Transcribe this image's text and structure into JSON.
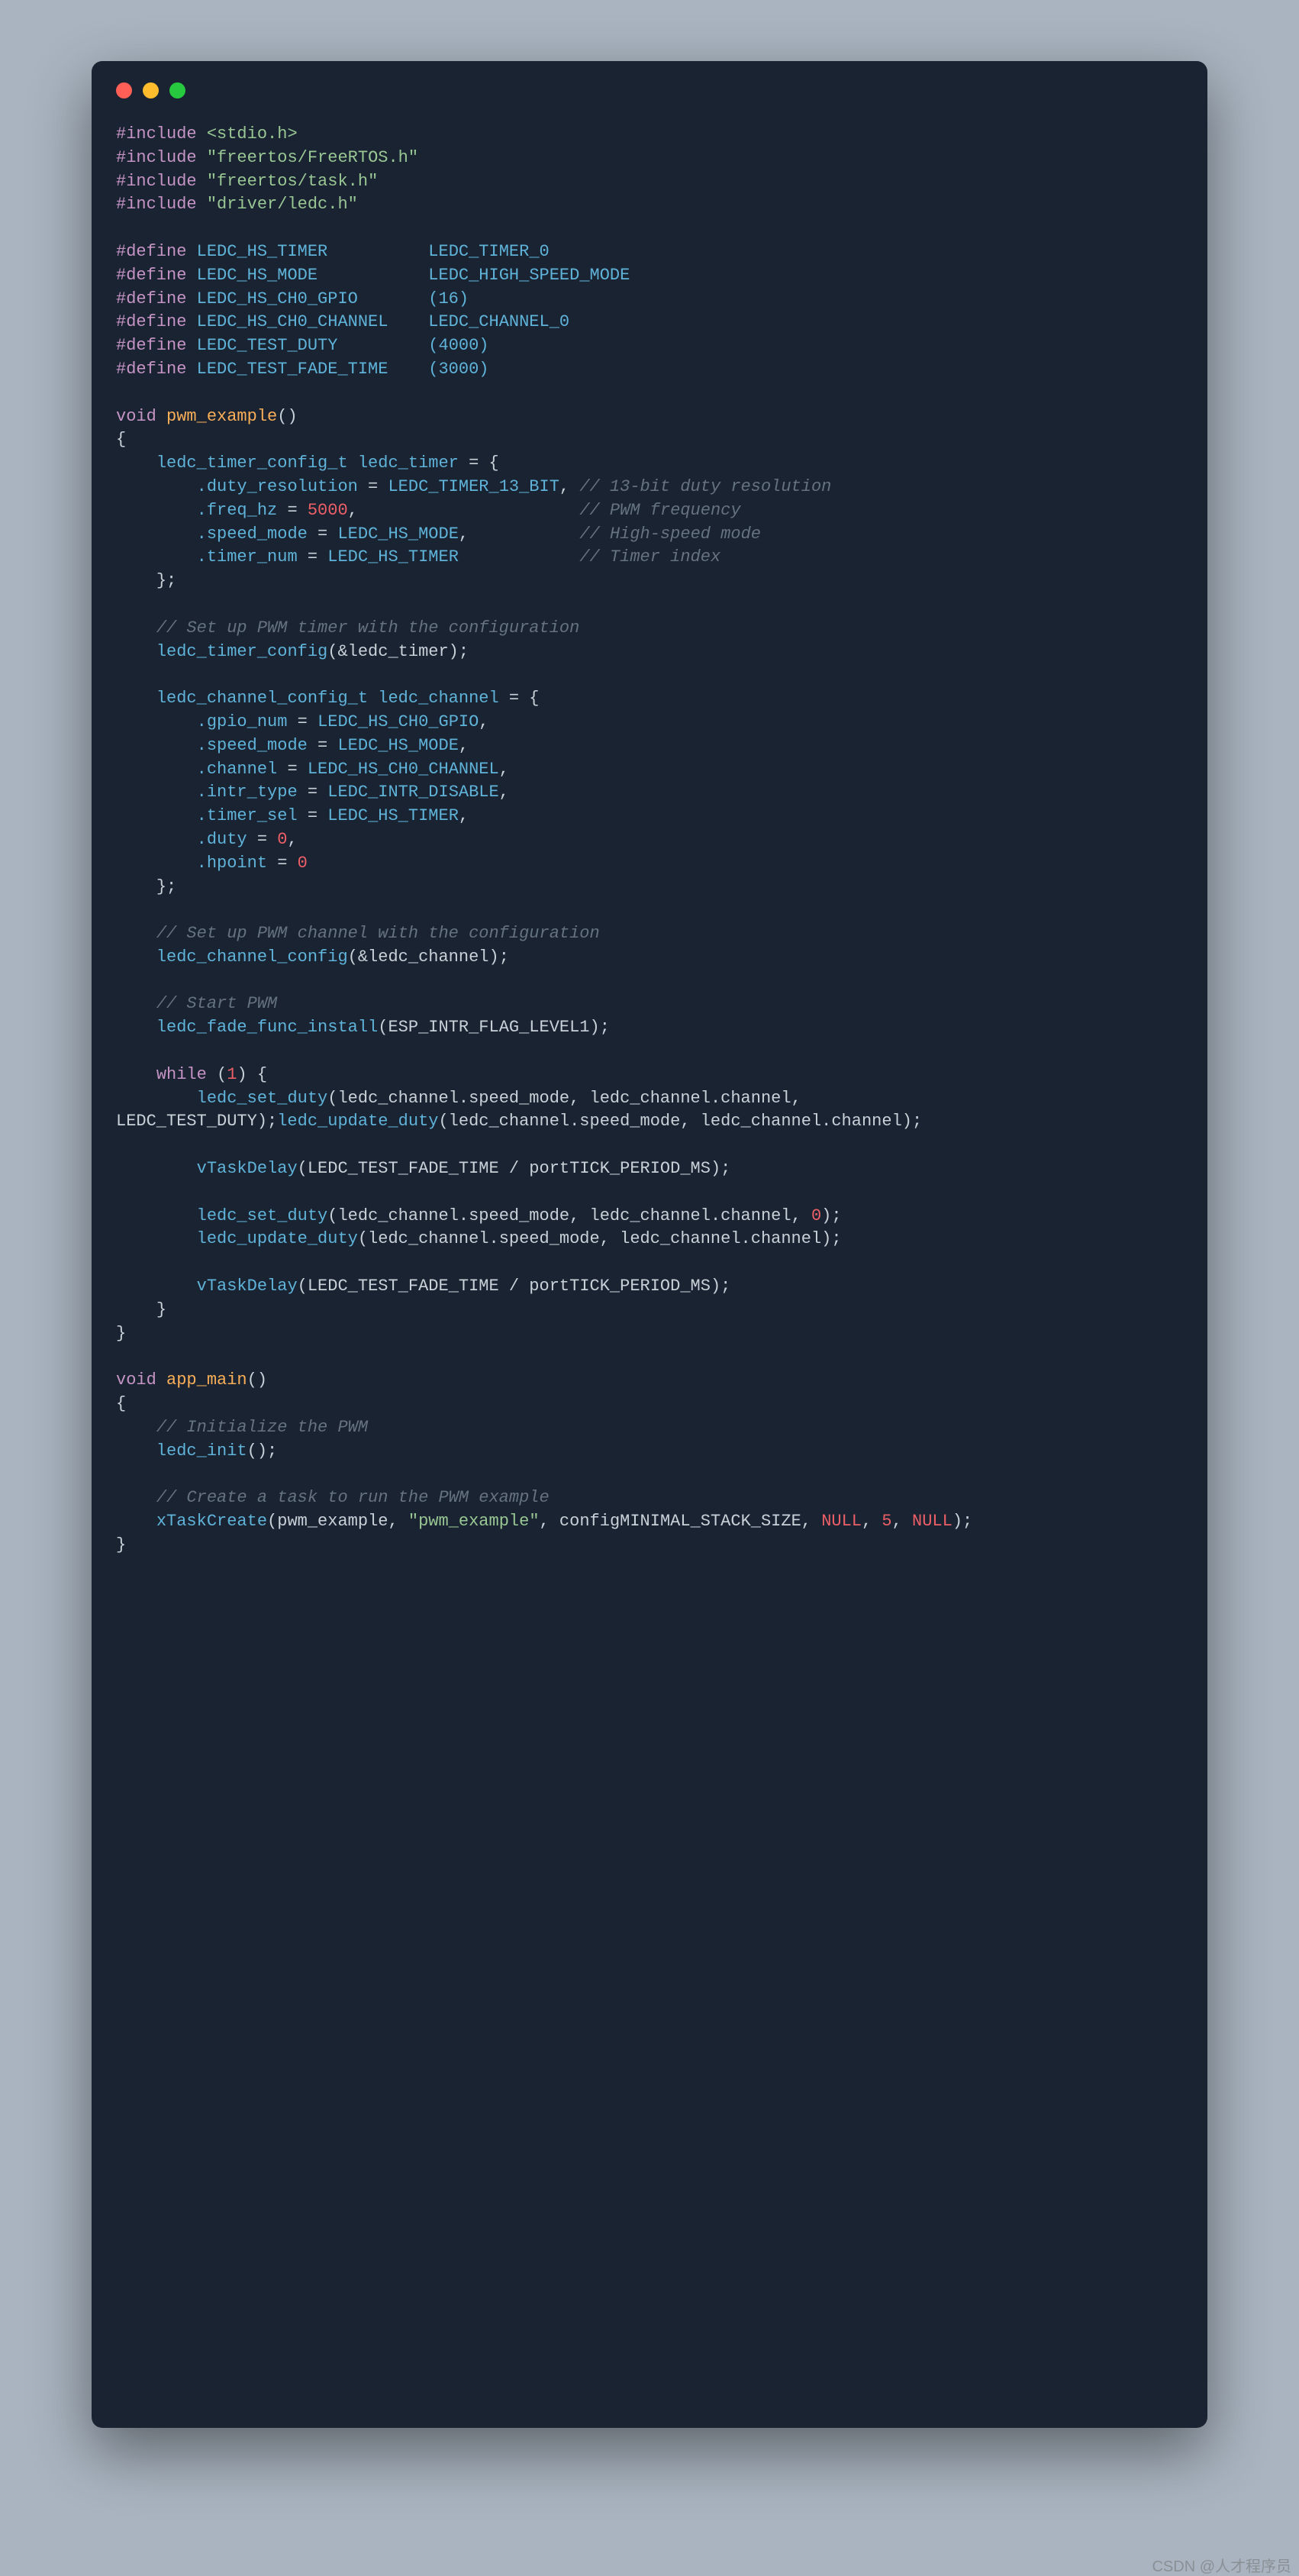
{
  "watermark": "CSDN @人才程序员",
  "traffic": {
    "red": "#ff5f56",
    "yellow": "#ffbd2e",
    "green": "#27c93f"
  },
  "code": {
    "l01": "#include",
    "l01b": "<stdio.h>",
    "l02": "#include",
    "l02b": "\"freertos/FreeRTOS.h\"",
    "l03": "#include",
    "l03b": "\"freertos/task.h\"",
    "l04": "#include",
    "l04b": "\"driver/ledc.h\"",
    "d1a": "#define",
    "d1b": "LEDC_HS_TIMER",
    "d1c": "LEDC_TIMER_0",
    "d2a": "#define",
    "d2b": "LEDC_HS_MODE",
    "d2c": "LEDC_HIGH_SPEED_MODE",
    "d3a": "#define",
    "d3b": "LEDC_HS_CH0_GPIO",
    "d3c": "(16)",
    "d4a": "#define",
    "d4b": "LEDC_HS_CH0_CHANNEL",
    "d4c": "LEDC_CHANNEL_0",
    "d5a": "#define",
    "d5b": "LEDC_TEST_DUTY",
    "d5c": "(4000)",
    "d6a": "#define",
    "d6b": "LEDC_TEST_FADE_TIME",
    "d6c": "(3000)",
    "kw_void": "void",
    "fn_pwm": "pwm_example",
    "obrace": "{",
    "cbrace": "}",
    "ty_timer": "ledc_timer_config_t",
    "var_timer": "ledc_timer",
    "eq": " = {",
    "m_duty_res": ".duty_resolution",
    "v_duty_res": "LEDC_TIMER_13_BIT",
    "c_duty_res": "// 13-bit duty resolution",
    "m_freq": ".freq_hz",
    "v_freq": "5000",
    "c_freq": "// PWM frequency",
    "m_speed": ".speed_mode",
    "v_speed": "LEDC_HS_MODE",
    "c_speed": "// High-speed mode",
    "m_timer": ".timer_num",
    "v_timer": "LEDC_HS_TIMER",
    "c_timer": "// Timer index",
    "close_init": "};",
    "c_setup_t": "// Set up PWM timer with the configuration",
    "fn_tcfg": "ledc_timer_config",
    "arg_tcfg": "(&ledc_timer);",
    "ty_chan": "ledc_channel_config_t",
    "var_chan": "ledc_channel",
    "m_gpio": ".gpio_num",
    "v_gpio": "LEDC_HS_CH0_GPIO",
    "m_speed2": ".speed_mode",
    "v_speed2": "LEDC_HS_MODE",
    "m_chan": ".channel",
    "v_chan": "LEDC_HS_CH0_CHANNEL",
    "m_intr": ".intr_type",
    "v_intr": "LEDC_INTR_DISABLE",
    "m_tsel": ".timer_sel",
    "v_tsel": "LEDC_HS_TIMER",
    "m_duty": ".duty",
    "v_zero": "0",
    "m_hpoint": ".hpoint",
    "c_setup_c": "// Set up PWM channel with the configuration",
    "fn_ccfg": "ledc_channel_config",
    "arg_ccfg": "(&ledc_channel);",
    "c_start": "// Start PWM",
    "fn_fade": "ledc_fade_func_install",
    "arg_fade": "(ESP_INTR_FLAG_LEVEL1);",
    "kw_while": "while",
    "one": "1",
    "fn_setduty": "ledc_set_duty",
    "arg_sd1a": "(ledc_channel.speed_mode, ledc_channel.channel,",
    "wrap_prefix": "LEDC_TEST_DUTY);",
    "fn_update_wrap": "ledc_update_duty",
    "arg_ud": "(ledc_channel.speed_mode, ledc_channel.channel);",
    "fn_delay": "vTaskDelay",
    "arg_delay": "(LEDC_TEST_FADE_TIME / portTICK_PERIOD_MS);",
    "arg_sd2": "(ledc_channel.speed_mode, ledc_channel.channel, ",
    "arg_sd2b": ");",
    "fn_update": "ledc_update_duty",
    "fn_appmain": "app_main",
    "c_init": "// Initialize the PWM",
    "fn_linit": "ledc_init",
    "arg_linit": "();",
    "c_task": "// Create a task to run the PWM example",
    "fn_xtask": "xTaskCreate",
    "arg_xt1": "(pwm_example, ",
    "arg_xt2": "\"pwm_example\"",
    "arg_xt3": ", configMINIMAL_STACK_SIZE, ",
    "null": "NULL",
    "five": "5",
    "comma": ", ",
    "close_call": ");"
  }
}
